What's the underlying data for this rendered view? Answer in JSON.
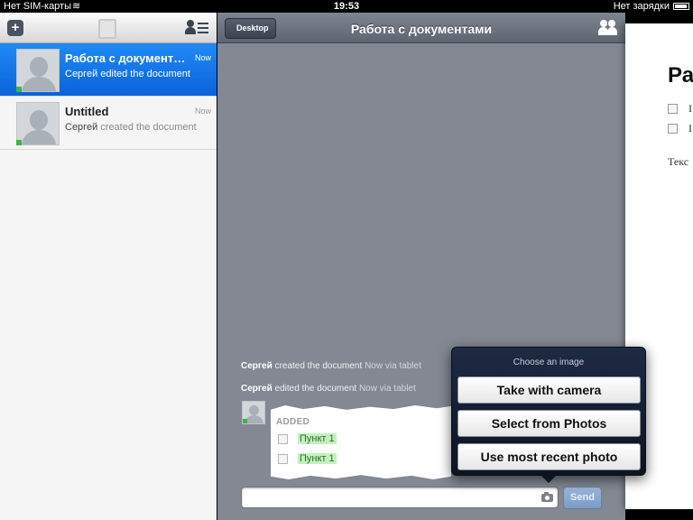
{
  "status_bar": {
    "carrier": "Нет SIM-карты",
    "time": "19:53",
    "charging": "Нет зарядки"
  },
  "sidebar": {
    "toolbar_icons": [
      "add-document-icon",
      "document-icon",
      "contacts-icon"
    ],
    "conversations": [
      {
        "title": "Работа с документа…",
        "author": "Сергей",
        "action": "edited the document",
        "time": "Now",
        "selected": true
      },
      {
        "title": "Untitled",
        "author": "Сергей",
        "action": "created the document",
        "time": "Now",
        "selected": false
      }
    ]
  },
  "chat": {
    "back_label": "Desktop",
    "title": "Работа с документами",
    "events": [
      {
        "author": "Сергей",
        "action": "created the document",
        "meta": "Now via tablet"
      },
      {
        "author": "Сергей",
        "action": "edited the document",
        "meta": "Now via tablet"
      }
    ],
    "card": {
      "header": "ADDED",
      "items": [
        "Пункт 1",
        "Пункт 1"
      ]
    },
    "send_label": "Send",
    "input_placeholder": ""
  },
  "popover": {
    "title": "Choose an image",
    "options": [
      "Take with camera",
      "Select from Photos",
      "Use most recent photo"
    ]
  },
  "document_preview": {
    "title": "Ра",
    "items": [
      "I",
      "I"
    ],
    "body": "Текс"
  },
  "colors": {
    "selection_blue": "#0b63d9",
    "online_green": "#3ab54a",
    "send_button": "#7c9bc4"
  }
}
